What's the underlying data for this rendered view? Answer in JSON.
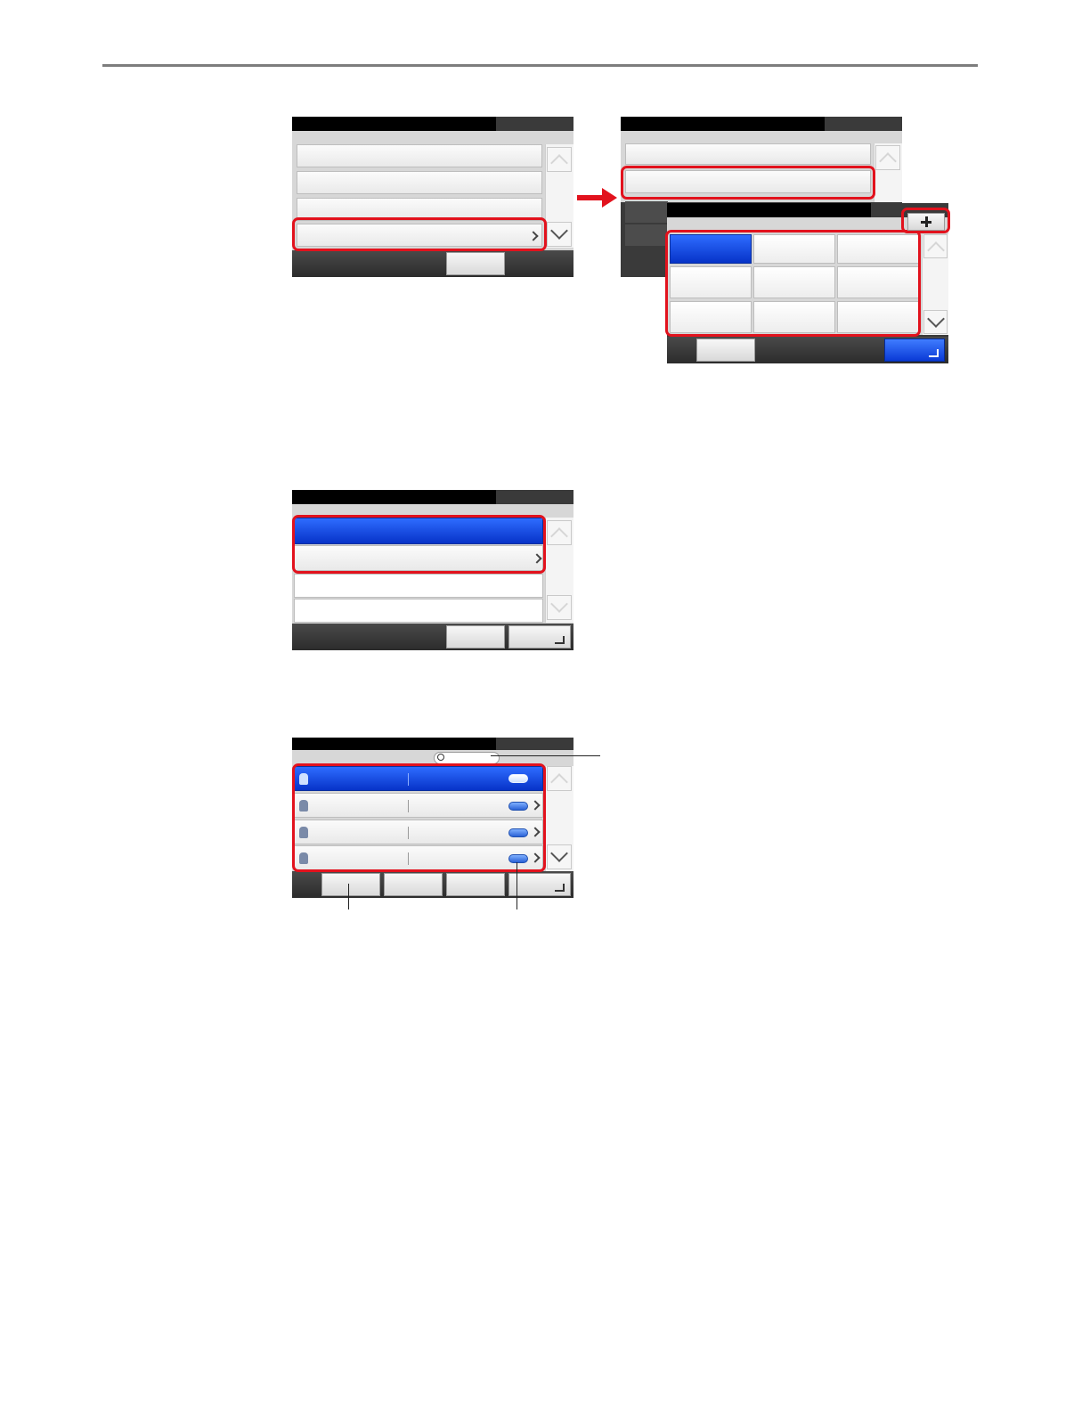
{
  "page": {
    "rule_color": "#7d7d7d",
    "footer_link": ""
  },
  "accents": {
    "highlight": "#e2121d",
    "selected": "#0a3ad6"
  },
  "screen_a": {
    "rows": [
      "",
      "",
      "",
      ""
    ]
  },
  "screen_b": {
    "rows": [
      "",
      ""
    ],
    "popup_add_icon": "plus-icon",
    "grid": [
      "",
      "",
      "",
      "",
      "",
      "",
      "",
      "",
      ""
    ]
  },
  "screen_c": {
    "rows": [
      "",
      "",
      "",
      ""
    ]
  },
  "screen_d": {
    "search_placeholder": "",
    "rows": [
      {
        "name": "",
        "number": ""
      },
      {
        "name": "",
        "number": ""
      },
      {
        "name": "",
        "number": ""
      },
      {
        "name": "",
        "number": ""
      }
    ]
  }
}
